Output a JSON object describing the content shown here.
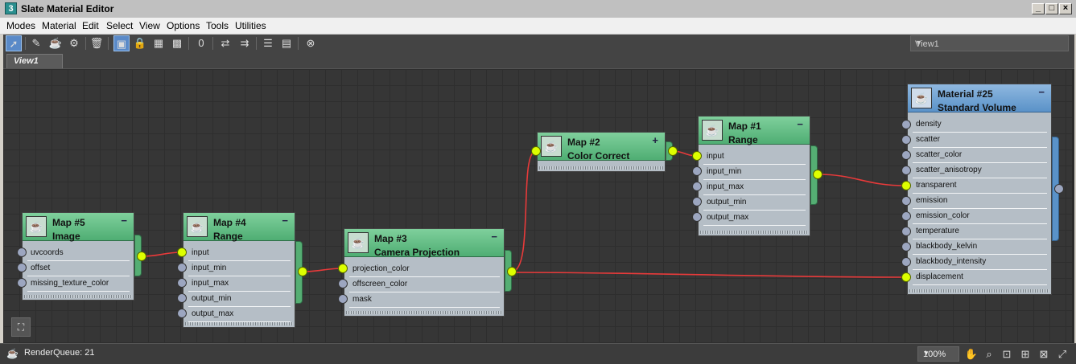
{
  "window": {
    "title": "Slate Material Editor",
    "app_icon_glyph": "3",
    "controls": [
      "_",
      "□",
      "×"
    ]
  },
  "menu": [
    "Modes",
    "Material",
    "Edit",
    "Select",
    "View",
    "Options",
    "Tools",
    "Utilities"
  ],
  "toolbar": {
    "icons": [
      "select-arrow-icon",
      "eyedropper-icon",
      "assign-material-icon",
      "pick-object-icon",
      "delete-icon",
      "move-children-icon",
      "lock-icon",
      "layout-all-icon",
      "checker-background-icon",
      "show-map-icon",
      "layout-icon",
      "layout-children-icon",
      "material-map-browser-icon",
      "parameter-editor-icon",
      "select-by-material-icon"
    ],
    "view_dropdown": "View1"
  },
  "tabs": [
    {
      "label": "View1"
    }
  ],
  "nodes": {
    "map5": {
      "name": "Map #5",
      "type": "Image",
      "collapse": "−",
      "slots": [
        "uvcoords",
        "offset",
        "missing_texture_color"
      ]
    },
    "map4": {
      "name": "Map #4",
      "type": "Range",
      "collapse": "−",
      "slots": [
        "input",
        "input_min",
        "input_max",
        "output_min",
        "output_max"
      ]
    },
    "map3": {
      "name": "Map #3",
      "type": "Camera Projection",
      "collapse": "−",
      "slots": [
        "projection_color",
        "offscreen_color",
        "mask"
      ]
    },
    "map2": {
      "name": "Map #2",
      "type": "Color Correct",
      "collapse": "+",
      "slots": []
    },
    "map1": {
      "name": "Map #1",
      "type": "Range",
      "collapse": "−",
      "slots": [
        "input",
        "input_min",
        "input_max",
        "output_min",
        "output_max"
      ]
    },
    "mat25": {
      "name": "Material #25",
      "type": "Standard Volume",
      "collapse": "−",
      "slots": [
        "density",
        "scatter",
        "scatter_color",
        "scatter_anisotropy",
        "transparent",
        "emission",
        "emission_color",
        "temperature",
        "blackbody_kelvin",
        "blackbody_intensity",
        "displacement"
      ]
    }
  },
  "connections": [
    {
      "from": "Map #5",
      "to": "Map #4.input"
    },
    {
      "from": "Map #4",
      "to": "Map #3.projection_color"
    },
    {
      "from": "Map #3",
      "to": "Map #2"
    },
    {
      "from": "Map #2",
      "to": "Map #1.input"
    },
    {
      "from": "Map #1",
      "to": "Material #25.transparent"
    },
    {
      "from": "Map #3",
      "to": "Material #25.displacement"
    }
  ],
  "colors": {
    "wire": "#e83a3a",
    "socket_active": "#ddff00",
    "map_header": "#5fbf82",
    "material_header": "#6a9fd0"
  },
  "status": {
    "render_queue": "RenderQueue: 21",
    "zoom": "100%"
  },
  "nav_icons": [
    "pan-hand-icon",
    "zoom-icon",
    "zoom-region-icon",
    "zoom-extents-icon",
    "zoom-extents-selected-icon",
    "maximize-icon"
  ]
}
